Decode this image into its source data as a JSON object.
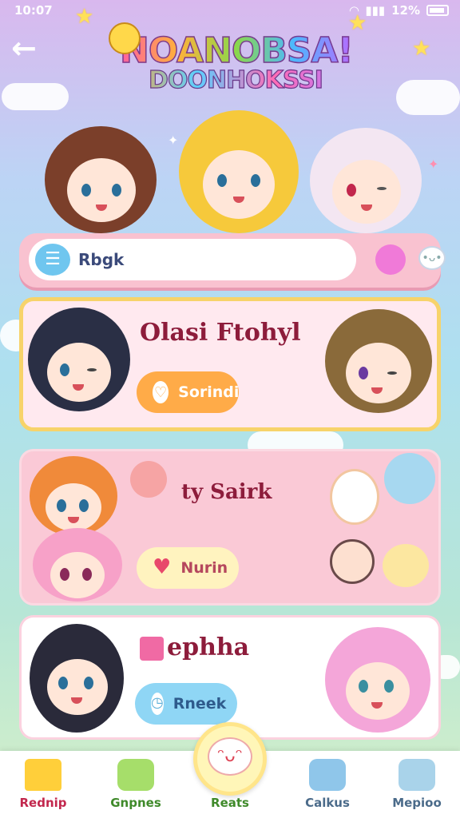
{
  "status_bar": {
    "time": "10:07",
    "battery": "12%"
  },
  "header": {
    "logo_line1": "NOANOBSA!",
    "logo_line2": "DOONHOKSSI"
  },
  "search": {
    "value": "Rbgk"
  },
  "cards": [
    {
      "title": "Olasi Ftohyl",
      "button_label": "Sorindi",
      "button_icon": "heart-outline-icon",
      "accent": "#ffab48"
    },
    {
      "title": "ty Sairk",
      "button_label": "Nurin",
      "button_icon": "heart-icon",
      "accent": "#fff3bf"
    },
    {
      "title": "ephha",
      "button_label": "Rneek",
      "button_icon": "timer-icon",
      "accent": "#8fd6f5"
    }
  ],
  "bottom_nav": {
    "items": [
      {
        "label": "Rednip",
        "icon": "home-icon",
        "color": "#c2274d"
      },
      {
        "label": "Gnpnes",
        "icon": "chat-icon",
        "color": "#3f8a2a"
      },
      {
        "label": "Reats",
        "icon": "smiley-icon",
        "color": "#3f8a2a"
      },
      {
        "label": "Calkus",
        "icon": "calendar-heart-icon",
        "color": "#4b6b8a"
      },
      {
        "label": "Mepioo",
        "icon": "tools-icon",
        "color": "#4b6b8a"
      }
    ]
  }
}
